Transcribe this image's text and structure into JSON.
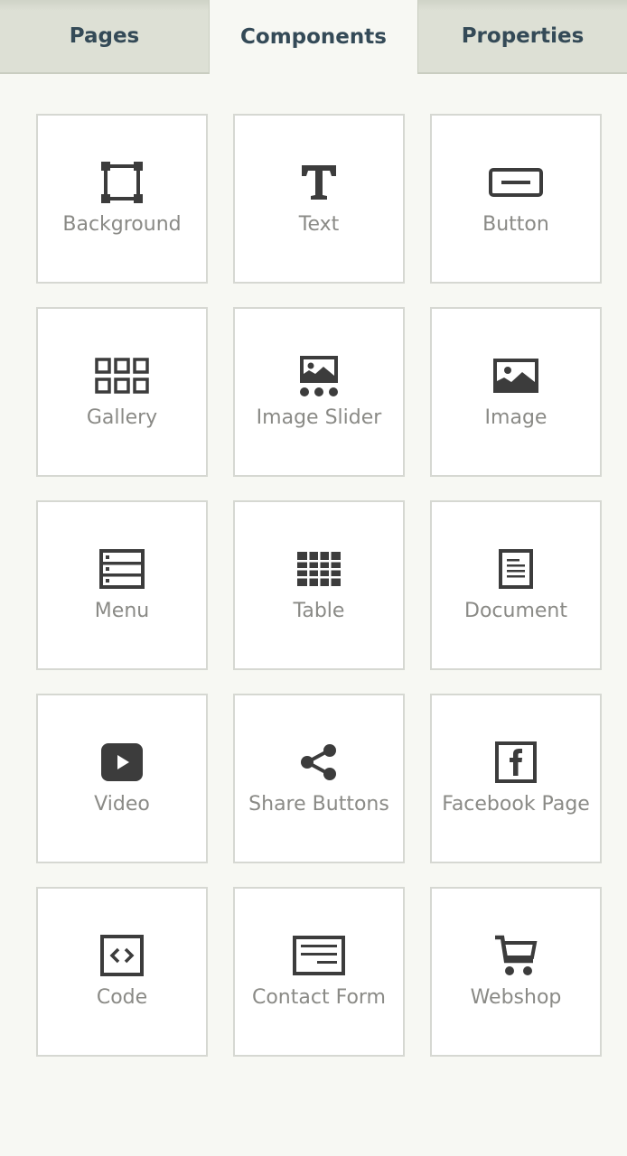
{
  "tabs": [
    {
      "label": "Pages",
      "active": false
    },
    {
      "label": "Components",
      "active": true
    },
    {
      "label": "Properties",
      "active": false
    }
  ],
  "components": [
    {
      "label": "Background",
      "icon": "background-icon"
    },
    {
      "label": "Text",
      "icon": "text-icon"
    },
    {
      "label": "Button",
      "icon": "button-icon"
    },
    {
      "label": "Gallery",
      "icon": "gallery-icon"
    },
    {
      "label": "Image Slider",
      "icon": "image-slider-icon"
    },
    {
      "label": "Image",
      "icon": "image-icon"
    },
    {
      "label": "Menu",
      "icon": "menu-icon"
    },
    {
      "label": "Table",
      "icon": "table-icon"
    },
    {
      "label": "Document",
      "icon": "document-icon"
    },
    {
      "label": "Video",
      "icon": "video-icon"
    },
    {
      "label": "Share Buttons",
      "icon": "share-icon"
    },
    {
      "label": "Facebook Page",
      "icon": "facebook-icon"
    },
    {
      "label": "Code",
      "icon": "code-icon"
    },
    {
      "label": "Contact Form",
      "icon": "contact-form-icon"
    },
    {
      "label": "Webshop",
      "icon": "cart-icon"
    }
  ],
  "colors": {
    "background": "#f7f8f3",
    "tab_inactive": "#dde0d5",
    "tab_text": "#344a57",
    "tile_border": "#d6d8d2",
    "icon": "#3c3c3c",
    "label": "#8a8a86"
  }
}
